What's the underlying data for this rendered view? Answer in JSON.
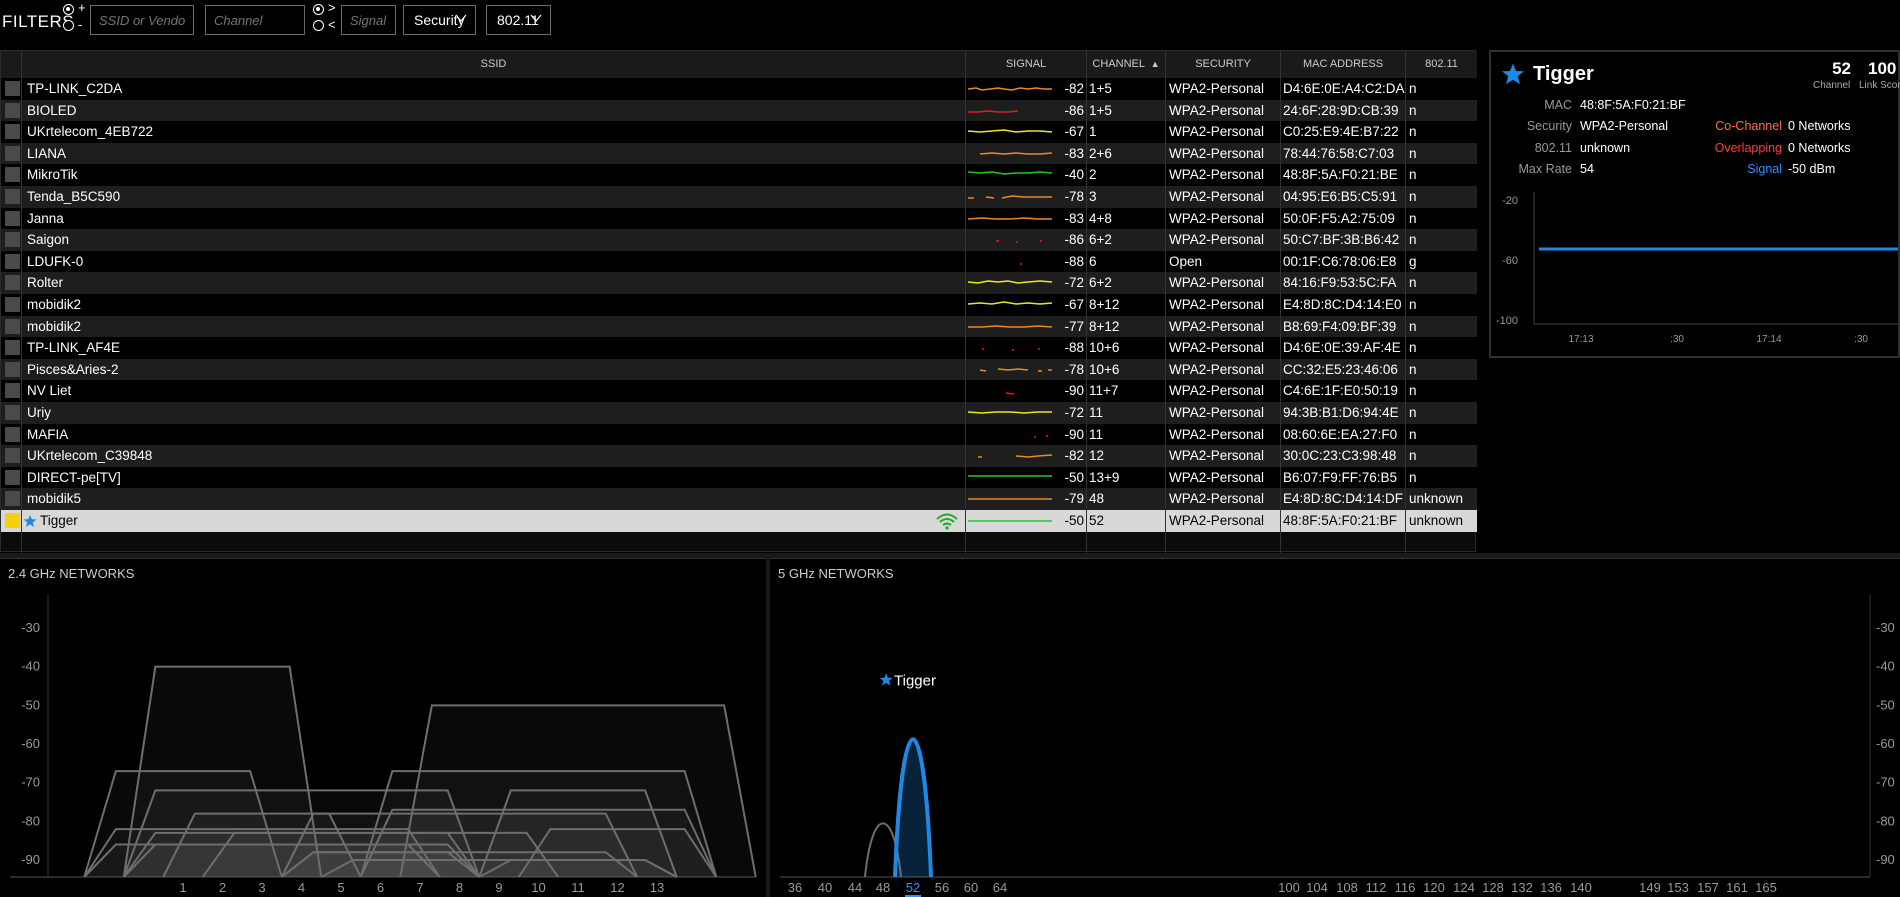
{
  "filters": {
    "title": "FILTERS",
    "plus": "+",
    "minus": "-",
    "gt": ">",
    "lt": "<",
    "ssid_placeholder": "SSID or Vendor",
    "channel_placeholder": "Channel",
    "signal_placeholder": "Signal",
    "security_label": "Security",
    "standard_label": "802.11"
  },
  "table": {
    "headers": {
      "ssid": "SSID",
      "signal": "SIGNAL",
      "channel": "CHANNEL",
      "sort_arrow": "▲",
      "security": "SECURITY",
      "mac": "MAC ADDRESS",
      "standard": "802.11"
    },
    "rows": [
      {
        "ssid": "TP-LINK_C2DA",
        "signal": "-82",
        "channel": "1+5",
        "security": "WPA2-Personal",
        "mac": "D4:6E:0E:A4:C2:DA",
        "std": "n",
        "color": "#e8892a"
      },
      {
        "ssid": "BIOLED",
        "signal": "-86",
        "channel": "1+5",
        "security": "WPA2-Personal",
        "mac": "24:6F:28:9D:CB:39",
        "std": "n",
        "color": "#e21c1c"
      },
      {
        "ssid": "UKrtelecom_4EB722",
        "signal": "-67",
        "channel": "1",
        "security": "WPA2-Personal",
        "mac": "C0:25:E9:4E:B7:22",
        "std": "n",
        "color": "#e6e62a"
      },
      {
        "ssid": "LIANA",
        "signal": "-83",
        "channel": "2+6",
        "security": "WPA2-Personal",
        "mac": "78:44:76:58:C7:03",
        "std": "n",
        "color": "#e8892a"
      },
      {
        "ssid": "MikroTik",
        "signal": "-40",
        "channel": "2",
        "security": "WPA2-Personal",
        "mac": "48:8F:5A:F0:21:BE",
        "std": "n",
        "color": "#22cc22"
      },
      {
        "ssid": "Tenda_B5C590",
        "signal": "-78",
        "channel": "3",
        "security": "WPA2-Personal",
        "mac": "04:95:E6:B5:C5:91",
        "std": "n",
        "color": "#e8892a"
      },
      {
        "ssid": "Janna",
        "signal": "-83",
        "channel": "4+8",
        "security": "WPA2-Personal",
        "mac": "50:0F:F5:A2:75:09",
        "std": "n",
        "color": "#e8892a"
      },
      {
        "ssid": "Saigon",
        "signal": "-86",
        "channel": "6+2",
        "security": "WPA2-Personal",
        "mac": "50:C7:BF:3B:B6:42",
        "std": "n",
        "color": "#e21c1c"
      },
      {
        "ssid": "LDUFK-0",
        "signal": "-88",
        "channel": "6",
        "security": "Open",
        "mac": "00:1F:C6:78:06:E8",
        "std": "g",
        "color": "#e21c1c"
      },
      {
        "ssid": "Rolter",
        "signal": "-72",
        "channel": "6+2",
        "security": "WPA2-Personal",
        "mac": "84:16:F9:53:5C:FA",
        "std": "n",
        "color": "#e6e62a"
      },
      {
        "ssid": "mobidik2",
        "signal": "-67",
        "channel": "8+12",
        "security": "WPA2-Personal",
        "mac": "E4:8D:8C:D4:14:E0",
        "std": "n",
        "color": "#e6e62a"
      },
      {
        "ssid": "mobidik2",
        "signal": "-77",
        "channel": "8+12",
        "security": "WPA2-Personal",
        "mac": "B8:69:F4:09:BF:39",
        "std": "n",
        "color": "#e8892a"
      },
      {
        "ssid": "TP-LINK_AF4E",
        "signal": "-88",
        "channel": "10+6",
        "security": "WPA2-Personal",
        "mac": "D4:6E:0E:39:AF:4E",
        "std": "n",
        "color": "#e21c1c"
      },
      {
        "ssid": "Pisces&Aries-2",
        "signal": "-78",
        "channel": "10+6",
        "security": "WPA2-Personal",
        "mac": "CC:32:E5:23:46:06",
        "std": "n",
        "color": "#e8892a"
      },
      {
        "ssid": "NV Liet",
        "signal": "-90",
        "channel": "11+7",
        "security": "WPA2-Personal",
        "mac": "C4:6E:1F:E0:50:19",
        "std": "n",
        "color": "#e21c1c"
      },
      {
        "ssid": "Uriy",
        "signal": "-72",
        "channel": "11",
        "security": "WPA2-Personal",
        "mac": "94:3B:B1:D6:94:4E",
        "std": "n",
        "color": "#e6e62a"
      },
      {
        "ssid": "MAFIA",
        "signal": "-90",
        "channel": "11",
        "security": "WPA2-Personal",
        "mac": "08:60:6E:EA:27:F0",
        "std": "n",
        "color": "#e21c1c"
      },
      {
        "ssid": "UKrtelecom_C39848",
        "signal": "-82",
        "channel": "12",
        "security": "WPA2-Personal",
        "mac": "30:0C:23:C3:98:48",
        "std": "n",
        "color": "#e8892a"
      },
      {
        "ssid": "DIRECT-pe[TV]",
        "signal": "-50",
        "channel": "13+9",
        "security": "WPA2-Personal",
        "mac": "B6:07:F9:FF:76:B5",
        "std": "n",
        "color": "#22cc22"
      },
      {
        "ssid": "mobidik5",
        "signal": "-79",
        "channel": "48",
        "security": "WPA2-Personal",
        "mac": "E4:8D:8C:D4:14:DF",
        "std": "unknown",
        "color": "#e8892a"
      },
      {
        "ssid": "Tigger",
        "signal": "-50",
        "channel": "52",
        "security": "WPA2-Personal",
        "mac": "48:8F:5A:F0:21:BF",
        "std": "unknown",
        "color": "#22cc22",
        "selected": true
      }
    ]
  },
  "detail": {
    "name": "Tigger",
    "channel_value": "52",
    "channel_label": "Channel",
    "score_value": "100",
    "score_label": "Link Score",
    "mac_label": "MAC",
    "mac_value": "48:8F:5A:F0:21:BF",
    "security_label": "Security",
    "security_value": "WPA2-Personal",
    "std_label": "802.11",
    "std_value": "unknown",
    "maxrate_label": "Max Rate",
    "maxrate_value": "54",
    "cochannel_label": "Co-Channel",
    "cochannel_value": "0 Networks",
    "overlap_label": "Overlapping",
    "overlap_value": "0 Networks",
    "signal_label": "Signal",
    "signal_value": "-50 dBm",
    "chart": {
      "y_ticks": [
        "-20",
        "-60",
        "-100"
      ],
      "x_ticks": [
        "17:13",
        ":30",
        "17:14",
        ":30"
      ],
      "signal_dbm": -50
    }
  },
  "band24": {
    "title": "2.4 GHz NETWORKS",
    "y_ticks": [
      "-30",
      "-40",
      "-50",
      "-60",
      "-70",
      "-80",
      "-90"
    ],
    "x_ticks": [
      "1",
      "2",
      "3",
      "4",
      "5",
      "6",
      "7",
      "8",
      "9",
      "10",
      "11",
      "12",
      "13"
    ]
  },
  "band5": {
    "title": "5 GHz NETWORKS",
    "peak_label": "Tigger",
    "y_ticks": [
      "-30",
      "-40",
      "-50",
      "-60",
      "-70",
      "-80",
      "-90"
    ],
    "x_ticks": [
      "36",
      "40",
      "44",
      "48",
      "52",
      "56",
      "60",
      "64",
      "100",
      "104",
      "108",
      "112",
      "116",
      "120",
      "124",
      "128",
      "132",
      "136",
      "140",
      "149",
      "153",
      "157",
      "161",
      "165"
    ]
  },
  "colors": {
    "accent_blue": "#1e88e5",
    "cochannel": "#ff7043",
    "overlap": "#ff3b3b",
    "signal_label": "#3b8cff",
    "selected_box": "#f5d10c"
  }
}
